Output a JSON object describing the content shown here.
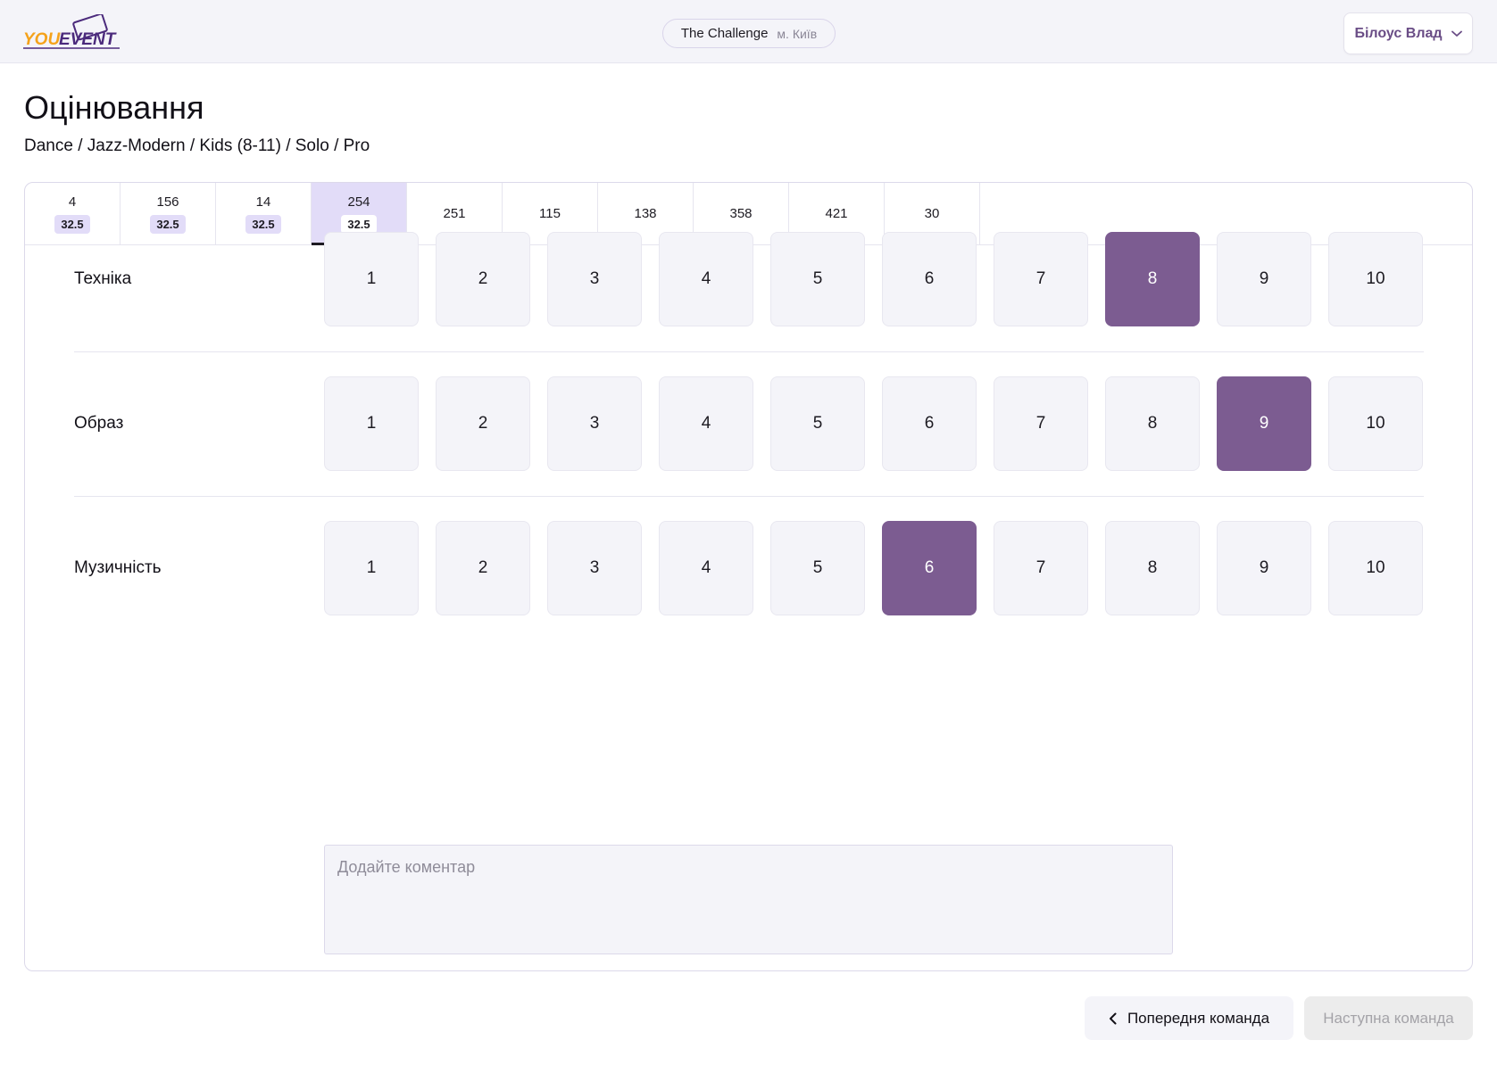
{
  "header": {
    "logo_text": "YOUEVENT",
    "event_name": "The Challenge",
    "event_city": "м. Київ",
    "user_name": "Білоус Влад"
  },
  "page": {
    "title": "Оцінювання",
    "breadcrumb": "Dance / Jazz-Modern / Kids (8-11) / Solo / Pro"
  },
  "tabs": [
    {
      "number": "4",
      "score": "32.5"
    },
    {
      "number": "156",
      "score": "32.5"
    },
    {
      "number": "14",
      "score": "32.5"
    },
    {
      "number": "254",
      "score": "32.5",
      "active": true
    },
    {
      "number": "251"
    },
    {
      "number": "115"
    },
    {
      "number": "138"
    },
    {
      "number": "358"
    },
    {
      "number": "421"
    },
    {
      "number": "30"
    }
  ],
  "criteria": [
    {
      "label": "Техніка",
      "selected": 8
    },
    {
      "label": "Образ",
      "selected": 9
    },
    {
      "label": "Музичність",
      "selected": 6
    }
  ],
  "score_options": [
    "1",
    "2",
    "3",
    "4",
    "5",
    "6",
    "7",
    "8",
    "9",
    "10"
  ],
  "comment": {
    "placeholder": "Додайте коментар",
    "value": ""
  },
  "footer": {
    "prev_label": "Попередня команда",
    "next_label": "Наступна команда"
  },
  "colors": {
    "accent": "#7c5c91",
    "active_tab": "#e2dcf8",
    "cell_bg": "#f4f4f9",
    "logo_orange": "#f5a21b",
    "logo_purple": "#4b2a7c"
  }
}
